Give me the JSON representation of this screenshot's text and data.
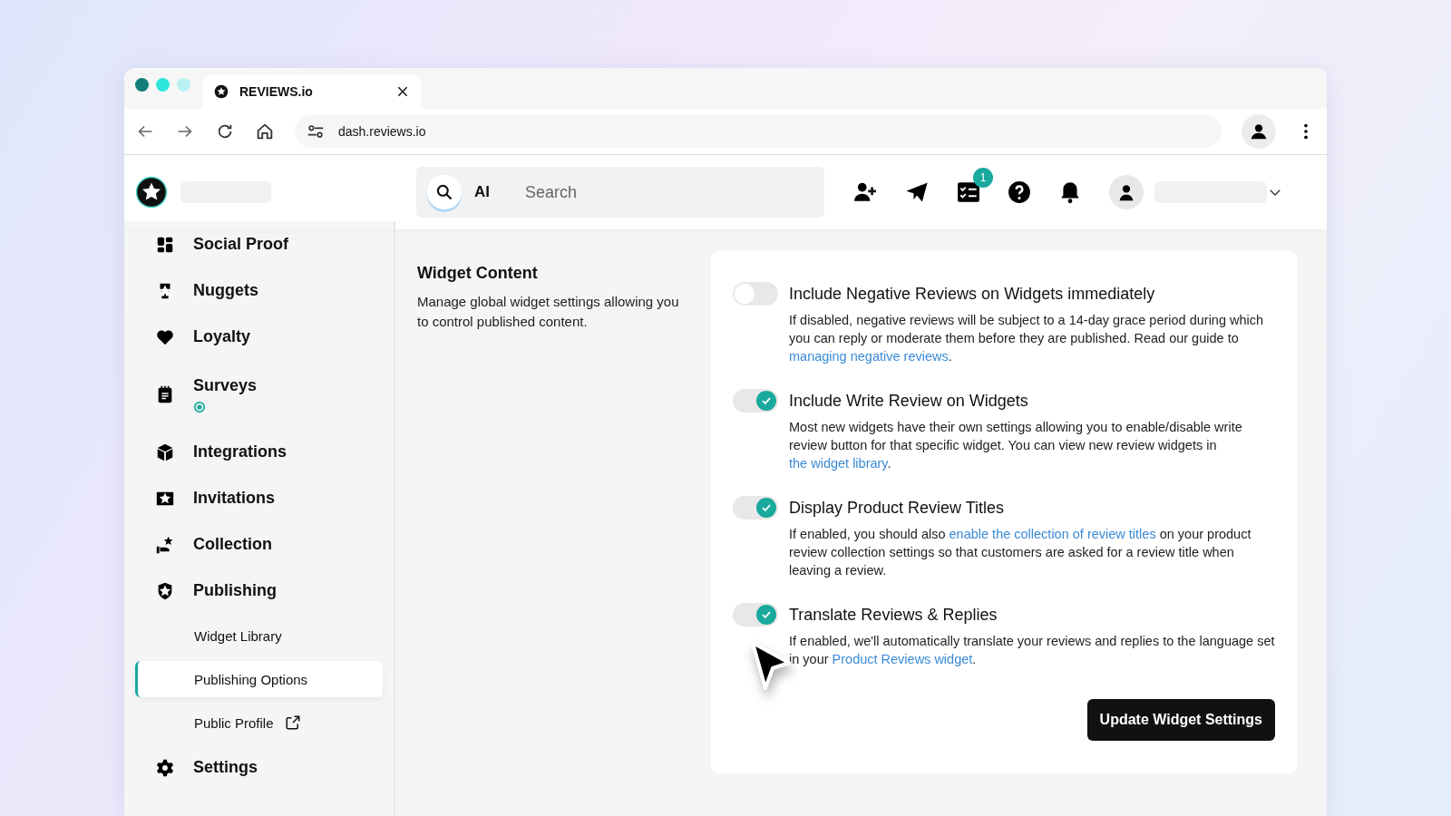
{
  "browser": {
    "tab": {
      "title": "REVIEWS.io"
    },
    "address": "dash.reviews.io"
  },
  "header": {
    "search": {
      "chip": "AI",
      "placeholder": "Search"
    },
    "tasks_badge": "1"
  },
  "sidebar": {
    "items": [
      {
        "label": "Social Proof",
        "kind": "social"
      },
      {
        "label": "Nuggets",
        "kind": "trophy"
      },
      {
        "label": "Loyalty",
        "kind": "heart"
      },
      {
        "label": "Surveys",
        "kind": "survey",
        "status": true
      },
      {
        "label": "Integrations",
        "kind": "cube"
      },
      {
        "label": "Invitations",
        "kind": "mail"
      },
      {
        "label": "Collection",
        "kind": "collect"
      },
      {
        "label": "Publishing",
        "kind": "shield",
        "children": [
          {
            "label": "Widget Library",
            "selected": false,
            "external": false
          },
          {
            "label": "Publishing Options",
            "selected": true,
            "external": false
          },
          {
            "label": "Public Profile",
            "selected": false,
            "external": true
          }
        ]
      },
      {
        "label": "Settings",
        "kind": "gear"
      }
    ]
  },
  "section": {
    "title": "Widget Content",
    "description": "Manage global widget settings allowing you to control published content."
  },
  "settings": [
    {
      "title": "Include Negative Reviews on Widgets immediately",
      "on": false,
      "description": [
        {
          "kind": "text",
          "text": "If disabled, negative reviews will be subject to a 14-day grace period during which you can reply or moderate them before they are published. Read our guide to "
        },
        {
          "kind": "link",
          "text": "managing negative reviews"
        },
        {
          "kind": "text",
          "text": "."
        }
      ]
    },
    {
      "title": "Include Write Review on Widgets",
      "on": true,
      "description": [
        {
          "kind": "text",
          "text": "Most new widgets have their own settings allowing you to enable/disable write review button for that specific widget. You can view new review widgets in "
        },
        {
          "kind": "link",
          "text": "the widget library"
        },
        {
          "kind": "text",
          "text": "."
        }
      ]
    },
    {
      "title": "Display Product Review Titles",
      "on": true,
      "description": [
        {
          "kind": "text",
          "text": "If enabled, you should also "
        },
        {
          "kind": "link",
          "text": "enable the collection of review titles"
        },
        {
          "kind": "text",
          "text": " on your product review collection settings so that customers are asked for a review title when leaving a review."
        }
      ]
    },
    {
      "title": "Translate Reviews & Replies",
      "on": true,
      "description": [
        {
          "kind": "text",
          "text": "If enabled, we'll automatically translate your reviews and replies to the language set in your "
        },
        {
          "kind": "link",
          "text": "Product Reviews widget"
        },
        {
          "kind": "text",
          "text": "."
        }
      ]
    }
  ],
  "submit": "Update Widget Settings"
}
